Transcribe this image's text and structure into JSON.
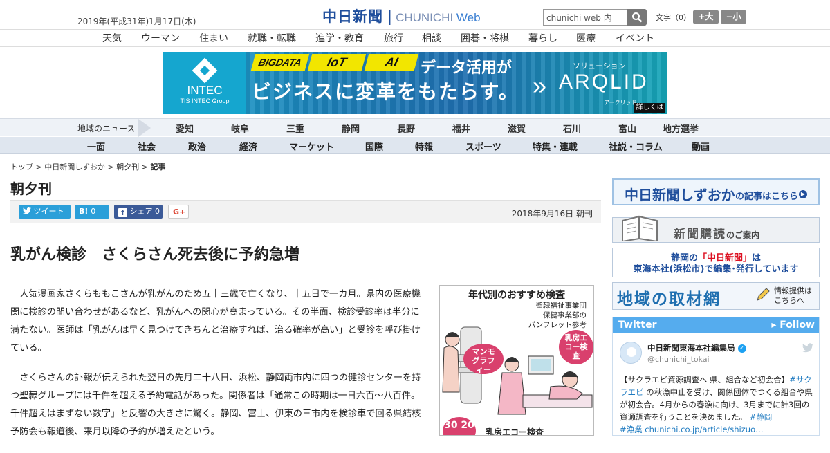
{
  "header": {
    "date": "2019年(平成31年)1月17日(木)",
    "logo_jp": "中日新聞",
    "logo_en_1": "CHUNICHI",
    "logo_en_2": "Web",
    "search_value": "chunichi web 内",
    "fontsize_label": "文字（0）",
    "font_larger": "+大",
    "font_smaller": "−小"
  },
  "subnav": [
    "天気",
    "ウーマン",
    "住まい",
    "就職・転職",
    "進学・教育",
    "旅行",
    "相談",
    "囲碁・将棋",
    "暮らし",
    "医療",
    "イベント"
  ],
  "banner": {
    "brand": "INTEC",
    "brand_sub": "TIS INTEC Group",
    "tags": [
      "BIGDATA",
      "IoT",
      "AI"
    ],
    "line1": "データ活用が",
    "line2": "ビジネスに変革をもたらす。",
    "solution": "ソリューション",
    "product": "ARQLID",
    "product_kana": "アークリッド",
    "detail": "詳しくは"
  },
  "regional_nav": {
    "label": "地域のニュース",
    "items": [
      "愛知",
      "岐阜",
      "三重",
      "静岡",
      "長野",
      "福井",
      "滋賀",
      "石川",
      "富山",
      "地方選挙"
    ]
  },
  "category_nav": [
    "一面",
    "社会",
    "政治",
    "経済",
    "マーケット",
    "国際",
    "特報",
    "スポーツ",
    "特集・連載",
    "社説・コラム",
    "動画"
  ],
  "breadcrumb": {
    "items": [
      "トップ",
      "中日新聞しずおか",
      "朝夕刊"
    ],
    "current": "記事",
    "sep": " > "
  },
  "section_title": "朝夕刊",
  "share": {
    "tweet": "ツイート",
    "hatena": "B!",
    "hatena_count": "0",
    "facebook": "シェア",
    "facebook_count": "0",
    "gplus": "G+"
  },
  "pubdate": "2018年9月16日 朝刊",
  "headline": "乳がん検診　さくらさん死去後に予約急増",
  "body": [
    "人気漫画家さくらももこさんが乳がんのため五十三歳で亡くなり、十五日で一カ月。県内の医療機関に検診の問い合わせがあるなど、乳がんへの関心が高まっている。その半面、検診受診率は半分に満たない。医師は「乳がんは早く見つけてきちんと治療すれば、治る確率が高い」と受診を呼び掛けている。",
    "さくらさんの訃報が伝えられた翌日の先月二十八日、浜松、静岡両市内に四つの健診センターを持つ聖隷グループには千件を超える予約電話があった。関係者は「通常この時期は一日六百～八百件。千件超えはまずない数字」と反響の大きさに驚く。静岡、富士、伊東の三市内を検診車で回る県結核予防会も報道後、来月以降の予約が増えたという。"
  ],
  "figure": {
    "title": "年代別のおすすめ検査",
    "source_1": "聖隷福祉事業団",
    "source_2": "保健事業部の",
    "source_3": "パンフレット参考",
    "bubble_1": "マンモグラフィー",
    "bubble_2": "乳房エコー検査",
    "age": "30 20",
    "caption": "乳房エコー検査"
  },
  "sidebar": {
    "shizuoka_main": "中日新聞しずおか",
    "shizuoka_sub": "の記事はこちら",
    "subscribe_main": "新聞購読",
    "subscribe_sub": "のご案内",
    "hq_line1_a": "静岡の",
    "hq_line1_b": "「中日新聞」",
    "hq_line1_c": "は",
    "hq_line2": "東海本社(浜松市)で編集･発行しています",
    "local_main": "地域の取材網",
    "local_sub_1": "情報提供は",
    "local_sub_2": "こちらへ"
  },
  "twitter": {
    "title": "Twitter",
    "follow": "▸ Follow",
    "name": "中日新聞東海本社編集局",
    "handle": "@chunichi_tokai",
    "text_1": "【サクラエビ資源調査へ 県、組合など初会合】",
    "hashtag_1": "#サクラエビ",
    "text_2": " の秋漁中止を受け、関係団体でつくる組合や県が初会合。4月からの春漁に向け、3月までに計3回の資源調査を行うことを決めました。",
    "hashtag_2": "#静岡",
    "hashtag_3": "#漁業",
    "link": " chunichi.co.jp/article/shizuo…"
  },
  "colors": {
    "brand_blue": "#1f4e9c",
    "twitter_blue": "#55acee",
    "nav_bg": "#dfe6ef"
  }
}
